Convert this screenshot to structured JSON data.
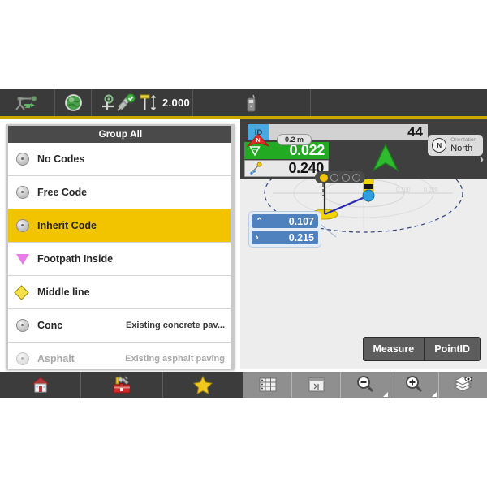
{
  "topbar": {
    "items": [
      {
        "icon": "survey-instrument-icon",
        "label": ""
      },
      {
        "icon": "globe-icon",
        "label": ""
      },
      {
        "icon": "target-point-icon",
        "label": ""
      },
      {
        "icon": "satellite-ok-icon",
        "label": ""
      },
      {
        "icon": "pole-height-icon",
        "label": "2.000"
      },
      {
        "icon": "radio-device-icon",
        "label": ""
      }
    ],
    "pole_height": "2.000"
  },
  "code_list": {
    "header": "Group All",
    "rows": [
      {
        "icon": "radio-icon",
        "label": "No Codes",
        "desc": "",
        "selected": false,
        "dim": false
      },
      {
        "icon": "radio-icon",
        "label": "Free Code",
        "desc": "",
        "selected": false,
        "dim": false
      },
      {
        "icon": "radio-icon",
        "label": "Inherit Code",
        "desc": "",
        "selected": true,
        "dim": false
      },
      {
        "icon": "triangle-icon",
        "label": "Footpath Inside",
        "desc": "",
        "selected": false,
        "dim": false
      },
      {
        "icon": "diamond-icon",
        "label": "Middle line",
        "desc": "",
        "selected": false,
        "dim": false
      },
      {
        "icon": "radio-icon",
        "label": "Conc",
        "desc": "Existing concrete pav...",
        "selected": false,
        "dim": false
      },
      {
        "icon": "radio-icon",
        "label": "Asphalt",
        "desc": "Existing asphalt paving",
        "selected": false,
        "dim": true
      }
    ]
  },
  "map": {
    "id_label": "ID",
    "id_value": "44",
    "readouts": [
      {
        "icon": "height-down-icon",
        "value": "0.022",
        "style": "green"
      },
      {
        "icon": "slope-stake-icon",
        "value": "0.240",
        "style": "grey"
      }
    ],
    "page_dots": {
      "count": 4,
      "active_index": 0
    },
    "scale_bar": "0.2 m",
    "north_marker": "N",
    "orientation": {
      "caption": "Orientation",
      "value": "North",
      "compass": "N"
    },
    "deltas": [
      {
        "glyph": "⌃",
        "icon": "chevron-up-icon",
        "value": "0.107"
      },
      {
        "glyph": "›",
        "icon": "chevron-right-icon",
        "value": "0.215"
      }
    ],
    "grid_labels": [
      "0.100",
      "0.200"
    ],
    "buttons": [
      {
        "label": "Measure"
      },
      {
        "label": "PointID"
      }
    ],
    "next_arrow": "›"
  },
  "bottombar": {
    "left": [
      {
        "icon": "home-icon"
      },
      {
        "icon": "toolbox-icon"
      },
      {
        "icon": "favorites-star-icon"
      }
    ],
    "right": [
      {
        "icon": "table-view-icon",
        "corner": false
      },
      {
        "icon": "map-properties-icon",
        "corner": false
      },
      {
        "icon": "zoom-out-icon",
        "corner": true
      },
      {
        "icon": "zoom-in-icon",
        "corner": true
      },
      {
        "icon": "layers-icon",
        "corner": false
      }
    ]
  },
  "colors": {
    "accent_yellow": "#f2c400",
    "green": "#23aa23",
    "blue": "#4e81bd",
    "id_blue": "#4aa8e0",
    "toolbar_dark": "#3a3a3a"
  }
}
